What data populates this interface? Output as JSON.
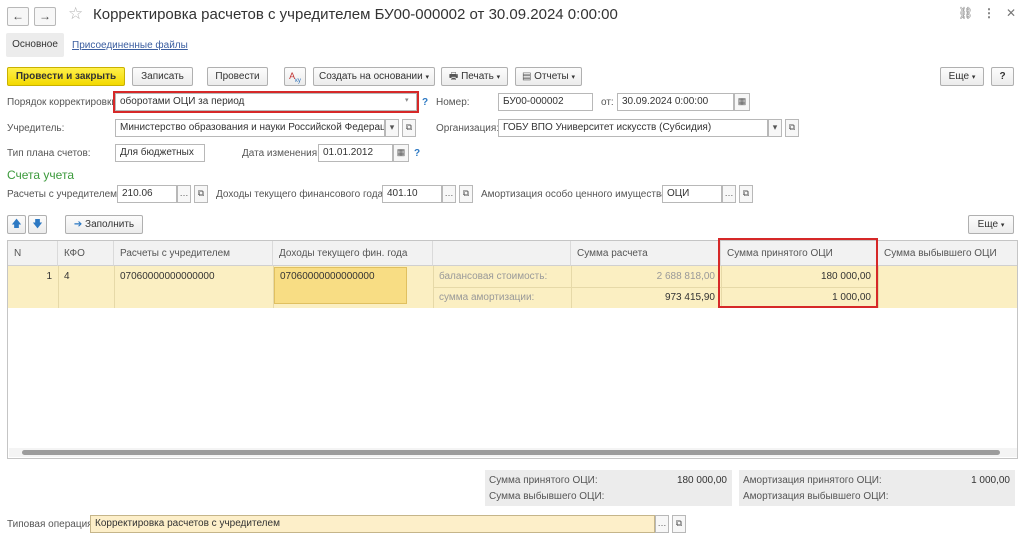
{
  "window": {
    "title": "Корректировка расчетов с учредителем БУ00-000002 от 30.09.2024 0:00:00",
    "back": "←",
    "forward": "→",
    "star": "☆",
    "link_icon": "🔗",
    "menu_icon": "⋮",
    "close_icon": "✕"
  },
  "tabs": {
    "main": "Основное",
    "attached": "Присоединенные файлы"
  },
  "toolbar": {
    "post_close": "Провести и закрыть",
    "save": "Записать",
    "post": "Провести",
    "create_based": "Создать на основании",
    "print": "Печать",
    "reports": "Отчеты",
    "more": "Еще",
    "help": "?"
  },
  "form": {
    "order_label": "Порядок корректировки:",
    "order_value": "оборотами ОЦИ за период",
    "number_label": "Номер:",
    "number_value": "БУ00-000002",
    "date_label": "от:",
    "date_value": "30.09.2024  0:00:00",
    "founder_label": "Учредитель:",
    "founder_value": "Министерство образования и науки Российской Федерации",
    "org_label": "Организация:",
    "org_value": "ГОБУ ВПО Университет искусств (Субсидия)",
    "plan_label": "Тип плана счетов:",
    "plan_value": "Для бюджетных",
    "change_date_label": "Дата изменения:",
    "change_date_value": "01.01.2012",
    "section_title": "Счета учета",
    "acc_founder_label": "Расчеты с учредителем:",
    "acc_founder_value": "210.06",
    "acc_income_label": "Доходы текущего финансового года:",
    "acc_income_value": "401.10",
    "acc_amort_label": "Амортизация особо ценного имущества:",
    "acc_amort_value": "ОЦИ"
  },
  "table_toolbar": {
    "fill": "Заполнить",
    "more": "Еще"
  },
  "table": {
    "headers": [
      "N",
      "КФО",
      "Расчеты с учредителем",
      "Доходы текущего фин. года",
      "",
      "Сумма расчета",
      "Сумма принятого ОЦИ",
      "Сумма выбывшего ОЦИ"
    ],
    "row": {
      "n": "1",
      "kfo": "4",
      "founder": "07060000000000000",
      "income": "07060000000000000",
      "label1": "балансовая стоимость:",
      "label2": "сумма амортизации:",
      "sum_calc_1": "2 688 818,00",
      "sum_calc_2": "973 415,90",
      "sum_accepted_1": "180 000,00",
      "sum_accepted_2": "1 000,00"
    }
  },
  "totals": {
    "accepted_label": "Сумма принятого ОЦИ:",
    "accepted_value": "180 000,00",
    "retired_label": "Сумма выбывшего ОЦИ:",
    "amort_accepted_label": "Амортизация принятого ОЦИ:",
    "amort_accepted_value": "1 000,00",
    "amort_retired_label": "Амортизация выбывшего ОЦИ:"
  },
  "footer": {
    "op_label": "Типовая операция:",
    "op_value": "Корректировка расчетов с учредителем"
  },
  "colors": {
    "primary_button": "#f3d900",
    "highlight": "#d62828",
    "section": "#3c9a3c",
    "row": "#fbefc2"
  }
}
